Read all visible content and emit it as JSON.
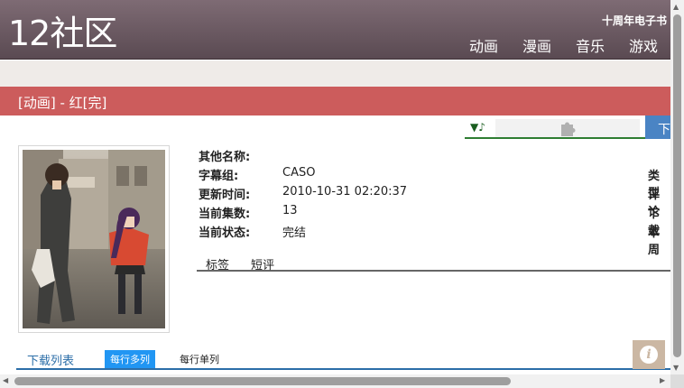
{
  "header": {
    "logo": "12社区",
    "anniversary_link": "十周年电子书",
    "nav": [
      "动画",
      "漫画",
      "音乐",
      "游戏"
    ]
  },
  "title_bar": {
    "text": "[动画] - 红[完]"
  },
  "player": {
    "toggle": "▼♪",
    "plugin_icon": "puzzle-piece-icon"
  },
  "download_tab": {
    "label": "下"
  },
  "details": {
    "rows": [
      {
        "label": "其他名称:",
        "value": "",
        "right": ""
      },
      {
        "label": "字幕组:",
        "value": "CASO",
        "right": "类型"
      },
      {
        "label": "更新时间:",
        "value": "2010-10-31 02:20:37",
        "right": "评论"
      },
      {
        "label": "当前集数:",
        "value": "13",
        "right": "下载"
      },
      {
        "label": "当前状态:",
        "value": "完结",
        "right": "本周"
      }
    ]
  },
  "tabs": [
    "标签",
    "短评"
  ],
  "download_list": {
    "title": "下载列表",
    "multi_column": "每行多列",
    "single_column": "每行单列"
  },
  "info_button": {
    "glyph": "i"
  },
  "colors": {
    "header": "#6b5a62",
    "title_bar": "#cc5c5c",
    "accent_blue": "#2b6ea8",
    "player_green": "#2e7d32"
  }
}
